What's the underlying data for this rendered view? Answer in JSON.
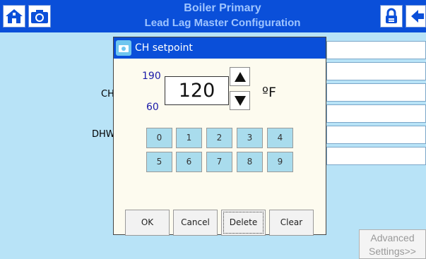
{
  "header": {
    "title_line1": "Boiler Primary",
    "title_line2": "Lead Lag Master Configuration",
    "home_icon": "home-icon",
    "camera_icon": "camera-icon",
    "lock_icon": "lock-icon",
    "back_icon": "back-arrow-icon"
  },
  "background": {
    "labels": [
      "CH",
      "DHW"
    ]
  },
  "dialog": {
    "title": "CH setpoint",
    "max": "190",
    "min": "60",
    "value": "120",
    "unit": "ºF",
    "keys_row1": [
      "0",
      "1",
      "2",
      "3",
      "4"
    ],
    "keys_row2": [
      "5",
      "6",
      "7",
      "8",
      "9"
    ],
    "actions": [
      "OK",
      "Cancel",
      "Delete",
      "Clear"
    ]
  },
  "footer": {
    "advanced_line1": "Advanced",
    "advanced_line2": "Settings>>"
  },
  "colors": {
    "header": "#0a4fd9",
    "background": "#b8e3f7",
    "keypad": "#a9dced",
    "range_text": "#1a1aa8"
  }
}
